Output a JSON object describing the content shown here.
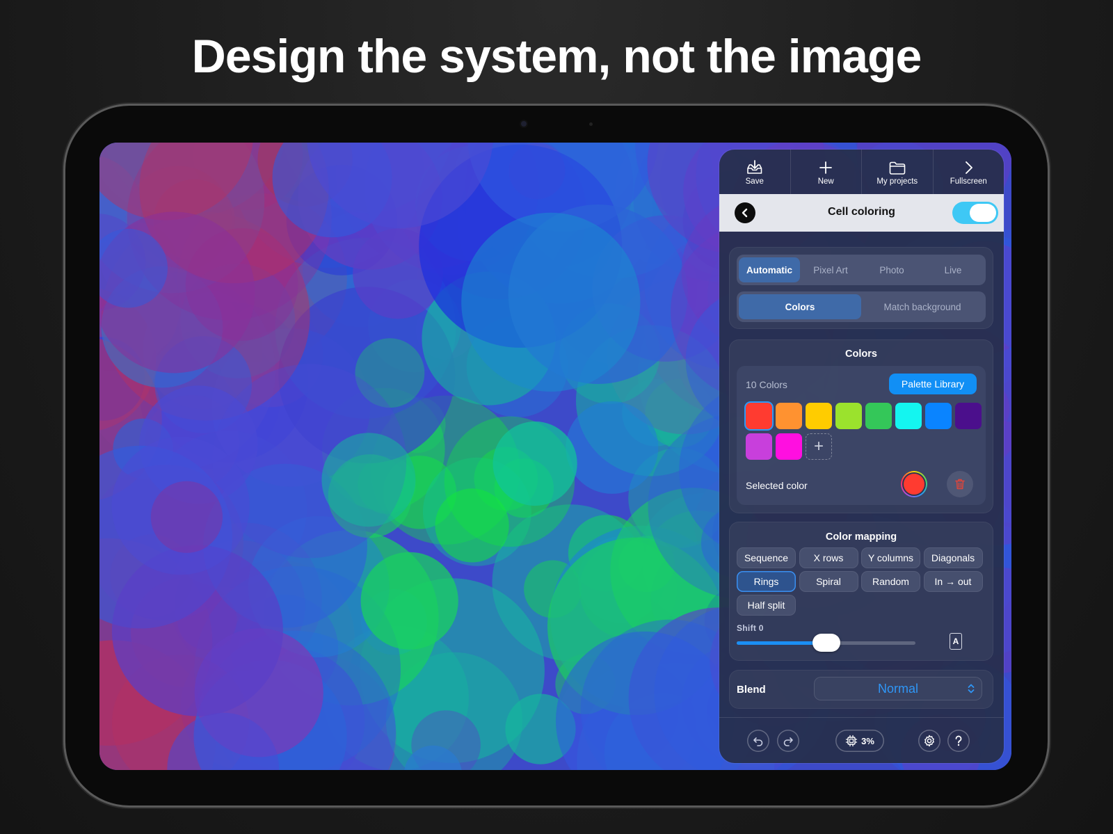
{
  "headline": "Design the system, not the image",
  "toolbar": {
    "save": "Save",
    "new": "New",
    "projects": "My projects",
    "fullscreen": "Fullscreen"
  },
  "header": {
    "title": "Cell coloring",
    "toggle_on": true
  },
  "mode_tabs": [
    "Automatic",
    "Pixel Art",
    "Photo",
    "Live"
  ],
  "mode_active": "Automatic",
  "color_source_tabs": [
    "Colors",
    "Match background"
  ],
  "color_source_active": "Colors",
  "colors_section": {
    "title": "Colors",
    "count_label": "10 Colors",
    "palette_button": "Palette Library",
    "swatches": [
      "#ff3b30",
      "#ff9230",
      "#ffcc00",
      "#9be22d",
      "#34c759",
      "#14f5f0",
      "#0a84ff",
      "#4b0f8c",
      "#c83fdc",
      "#ff0fe0"
    ],
    "selected_index": 0,
    "selected_label": "Selected color",
    "selected_color": "#ff3b30"
  },
  "mapping": {
    "title": "Color mapping",
    "options": [
      "Sequence",
      "X rows",
      "Y columns",
      "Diagonals",
      "Rings",
      "Spiral",
      "Random",
      "In → out",
      "Half split"
    ],
    "active": "Rings",
    "shift_label": "Shift  0",
    "shift_value": 0,
    "slider_fraction": 0.5,
    "auto_label": "A"
  },
  "blend": {
    "label": "Blend",
    "value": "Normal"
  },
  "bottom": {
    "usage": "3%"
  },
  "icons": [
    "save-icon",
    "plus-icon",
    "folder-icon",
    "chevron-right-icon",
    "chevron-left-icon",
    "trash-icon",
    "undo-icon",
    "redo-icon",
    "chip-icon",
    "gear-icon",
    "help-icon",
    "chevron-updown-icon"
  ],
  "accent": "#118ff5"
}
